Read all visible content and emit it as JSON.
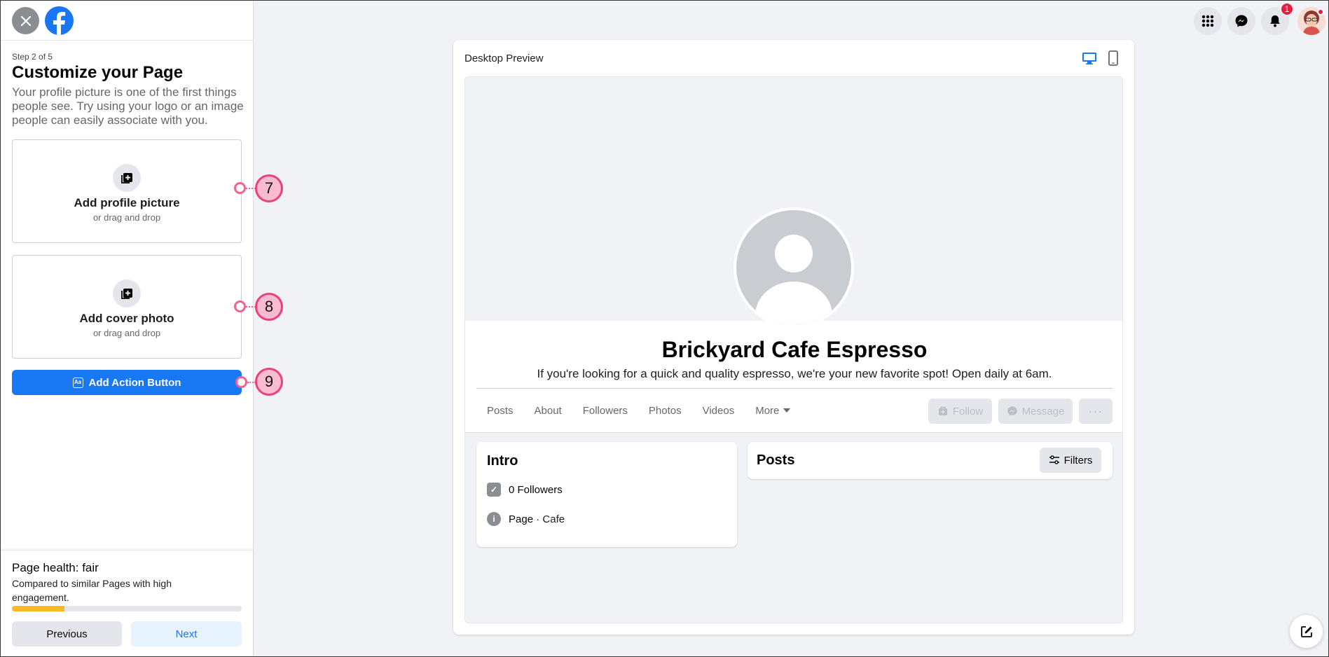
{
  "wizard": {
    "step": "Step 2 of 5",
    "title": "Customize your Page",
    "description": "Your profile picture is one of the first things people see. Try using your logo or an image people can easily associate with you.",
    "profile_card": {
      "label": "Add profile picture",
      "sub": "or drag and drop",
      "icon": "add-photo-icon"
    },
    "cover_card": {
      "label": "Add cover photo",
      "sub": "or drag and drop",
      "icon": "add-photo-icon"
    },
    "action_button": "Add Action Button",
    "callouts": [
      "7",
      "8",
      "9"
    ],
    "health": {
      "title": "Page health: fair",
      "description": "Compared to similar Pages with high engagement.",
      "progress": 0.23,
      "color": "#f7b928"
    },
    "prev_label": "Previous",
    "next_label": "Next"
  },
  "topbar": {
    "notification_count": "1",
    "icons": [
      "menu-grid-icon",
      "messenger-icon",
      "notifications-icon",
      "profile-avatar"
    ]
  },
  "preview": {
    "label": "Desktop Preview",
    "page_name": "Brickyard Cafe Espresso",
    "bio": "If you're looking for a quick and quality espresso, we're your new favorite spot! Open daily at 6am.",
    "tabs": [
      "Posts",
      "About",
      "Followers",
      "Photos",
      "Videos",
      "More"
    ],
    "buttons": {
      "follow": "Follow",
      "message": "Message",
      "more": "···"
    },
    "intro": {
      "title": "Intro",
      "followers": "0 Followers",
      "page_label": "Page",
      "separator": " · ",
      "category": "Cafe"
    },
    "posts": {
      "title": "Posts",
      "filters": "Filters"
    }
  },
  "colors": {
    "accent": "#1877f2",
    "callout": "#ec407a",
    "badge": "#e41e3f"
  }
}
